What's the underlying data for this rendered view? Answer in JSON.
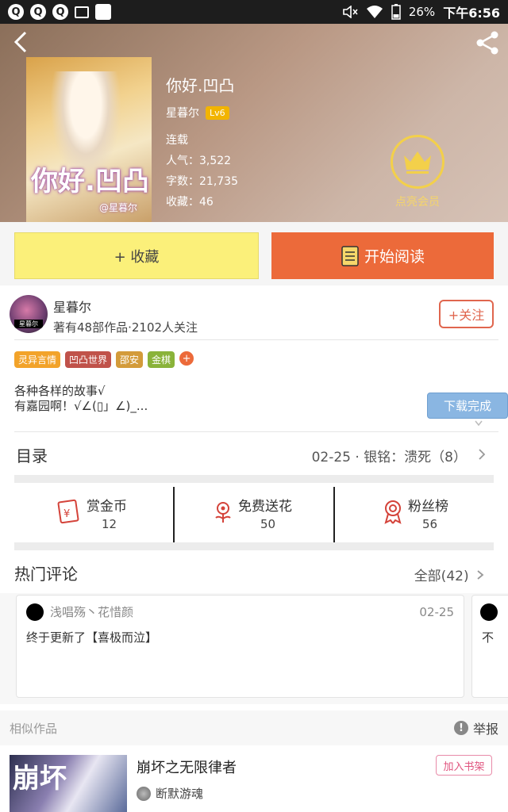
{
  "status_bar": {
    "left_icons": [
      "Q",
      "Q",
      "Q"
    ],
    "battery": "26%",
    "time": "下午6:56"
  },
  "book": {
    "cover_title": "你好.凹凸",
    "cover_author": "@星暮尔",
    "title": "你好.凹凸",
    "author": "星暮尔",
    "level": "Lv6",
    "status": "连载",
    "popularity": "人气：3,522",
    "word_count": "字数：21,735",
    "collections": "收藏：46",
    "vip_label": "点亮会员"
  },
  "actions": {
    "collect_label": "+ 收藏",
    "read_label": "开始阅读"
  },
  "author_panel": {
    "avatar_text": "星暮尔",
    "name": "星暮尔",
    "info": "著有48部作品·2102人关注",
    "follow_label": "+关注"
  },
  "tags": [
    {
      "label": "灵异言情",
      "color": "#f2a32a"
    },
    {
      "label": "凹凸世界",
      "color": "#c0524a"
    },
    {
      "label": "邵安",
      "color": "#d39b3a"
    },
    {
      "label": "金棋",
      "color": "#8ab33a"
    }
  ],
  "tag_more": "+",
  "intro": {
    "line1": "各种各样的故事√",
    "line2": "有嘉园啊！√∠(▯」∠)_..."
  },
  "download_toast": "下载完成",
  "catalog": {
    "title": "目录",
    "latest": "02-25 · 银铭：溃死（8）"
  },
  "rewards": [
    {
      "label": "赏金币",
      "value": "12",
      "icon": "money-envelope-icon",
      "color": "#d4433a"
    },
    {
      "label": "免费送花",
      "value": "50",
      "icon": "flower-icon",
      "color": "#d4433a"
    },
    {
      "label": "粉丝榜",
      "value": "56",
      "icon": "medal-icon",
      "color": "#d4433a"
    }
  ],
  "comments": {
    "title": "热门评论",
    "all_label": "全部(42)",
    "items": [
      {
        "user": "浅唱殇丶花惜颜",
        "date": "02-25",
        "text": "终于更新了【喜极而泣】"
      },
      {
        "text": "不"
      }
    ]
  },
  "similar": {
    "title": "相似作品",
    "report_label": "举报",
    "item": {
      "cover_text": "崩坏",
      "title": "崩坏之无限律者",
      "author": "断默游魂",
      "shelf_label": "加入书架"
    }
  }
}
